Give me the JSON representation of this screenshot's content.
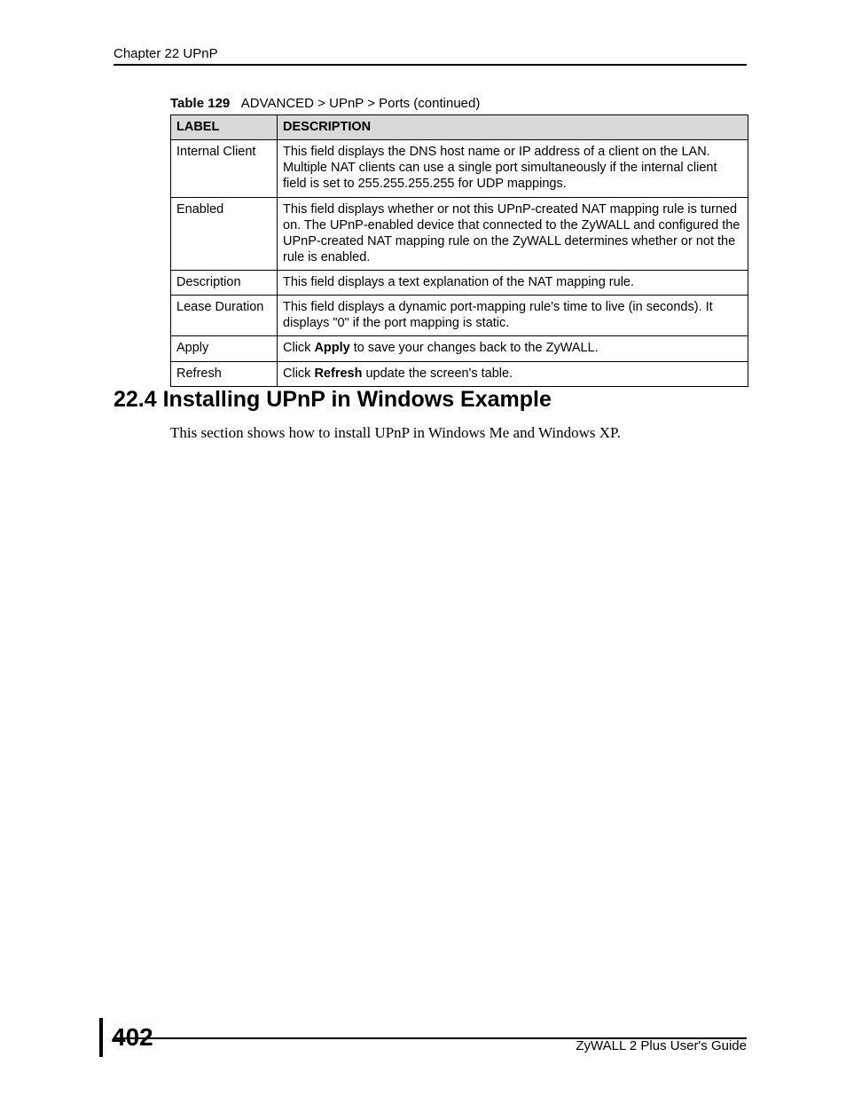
{
  "header": {
    "running_head": "Chapter 22 UPnP"
  },
  "table": {
    "caption_number": "Table 129",
    "caption_text": "ADVANCED > UPnP > Ports (continued)",
    "head_label": "LABEL",
    "head_desc": "DESCRIPTION",
    "rows": [
      {
        "label": "Internal Client",
        "desc_plain": "This field displays the DNS host name or IP address of a client on the LAN. Multiple NAT clients can use a single port simultaneously if the internal client field is set to 255.255.255.255 for UDP mappings."
      },
      {
        "label": "Enabled",
        "desc_plain": "This field displays whether or not this UPnP-created NAT mapping rule is turned on. The UPnP-enabled device that connected to the ZyWALL and configured the UPnP-created NAT mapping rule on the ZyWALL determines whether or not the rule is enabled."
      },
      {
        "label": "Description",
        "desc_plain": "This field displays a text explanation of the NAT mapping rule."
      },
      {
        "label": "Lease Duration",
        "desc_plain": "This field displays a dynamic port-mapping rule's time to live (in seconds). It displays \"0\" if the port mapping is static."
      },
      {
        "label": "Apply",
        "desc_pre": "Click ",
        "desc_bold": "Apply",
        "desc_post": " to save your changes back to the ZyWALL."
      },
      {
        "label": "Refresh",
        "desc_pre": "Click ",
        "desc_bold": "Refresh",
        "desc_post": " update the screen's table."
      }
    ]
  },
  "section": {
    "heading": "22.4  Installing UPnP in Windows Example",
    "body": "This section shows how to install UPnP in Windows Me and Windows XP."
  },
  "footer": {
    "page_number": "402",
    "guide": "ZyWALL 2 Plus User's Guide"
  }
}
